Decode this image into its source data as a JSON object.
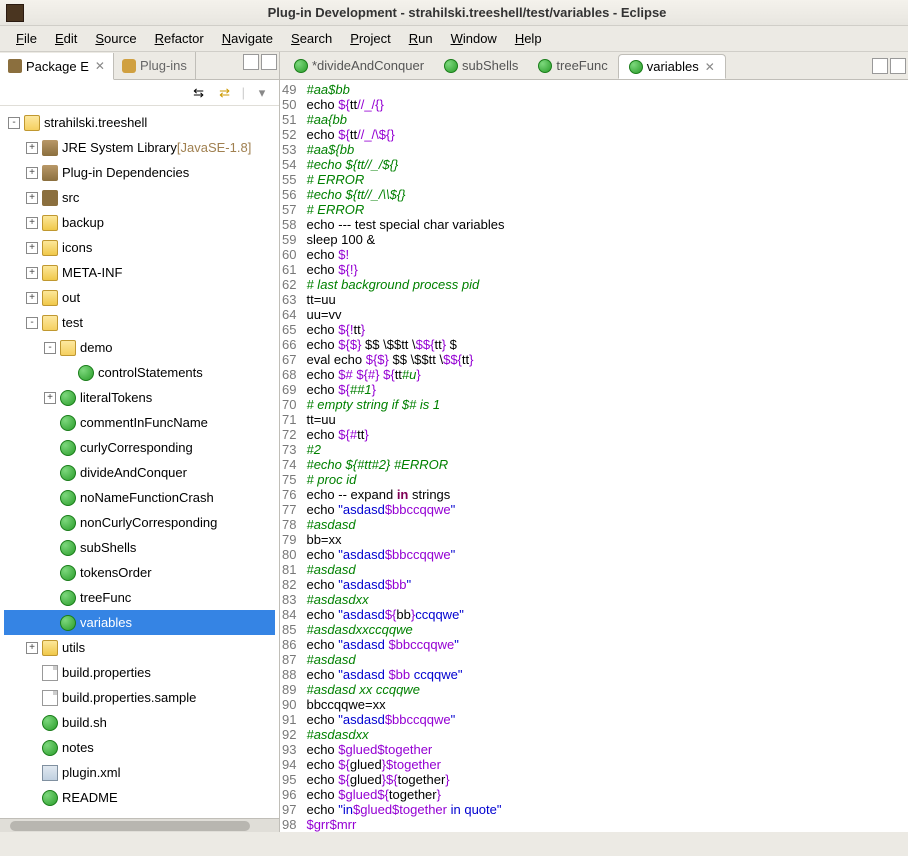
{
  "title": "Plug-in Development - strahilski.treeshell/test/variables - Eclipse",
  "menu": [
    "File",
    "Edit",
    "Source",
    "Refactor",
    "Navigate",
    "Search",
    "Project",
    "Run",
    "Window",
    "Help"
  ],
  "views": {
    "package_explorer": "Package E",
    "plugins": "Plug-ins"
  },
  "tree": {
    "project": "strahilski.treeshell",
    "jre": "JRE System Library",
    "jre_ver": "[JavaSE-1.8]",
    "plugin_deps": "Plug-in Dependencies",
    "src": "src",
    "backup": "backup",
    "icons": "icons",
    "meta": "META-INF",
    "out": "out",
    "test": "test",
    "demo": "demo",
    "controlStatements": "controlStatements",
    "literalTokens": "literalTokens",
    "commentInFuncName": "commentInFuncName",
    "curlyCorresponding": "curlyCorresponding",
    "divideAndConquer": "divideAndConquer",
    "noNameFunctionCrash": "noNameFunctionCrash",
    "nonCurlyCorresponding": "nonCurlyCorresponding",
    "subShells": "subShells",
    "tokensOrder": "tokensOrder",
    "treeFunc": "treeFunc",
    "variables": "variables",
    "utils": "utils",
    "build_props": "build.properties",
    "build_props_sample": "build.properties.sample",
    "build_sh": "build.sh",
    "notes": "notes",
    "plugin_xml": "plugin.xml",
    "readme": "README"
  },
  "editor_tabs": {
    "t1": "*divideAndConquer",
    "t2": "subShells",
    "t3": "treeFunc",
    "t4": "variables"
  },
  "code_start": 49,
  "code": [
    {
      "t": [
        [
          "g",
          "#aa$bb"
        ]
      ]
    },
    {
      "t": [
        [
          "",
          "echo "
        ],
        [
          "p",
          "${"
        ],
        [
          "",
          "tt"
        ],
        [
          "p",
          "//_/{}"
        ]
      ]
    },
    {
      "t": [
        [
          "g",
          "#aa{bb"
        ]
      ]
    },
    {
      "t": [
        [
          "",
          "echo "
        ],
        [
          "p",
          "${"
        ],
        [
          "",
          "tt"
        ],
        [
          "p",
          "//_/\\${}"
        ]
      ]
    },
    {
      "t": [
        [
          "g",
          "#aa${bb"
        ]
      ]
    },
    {
      "t": [
        [
          "g",
          "#echo ${tt//_/${}"
        ]
      ]
    },
    {
      "t": [
        [
          "g",
          "# ERROR"
        ]
      ]
    },
    {
      "t": [
        [
          "g",
          "#echo ${tt//_/\\\\${}"
        ]
      ]
    },
    {
      "t": [
        [
          "g",
          "# ERROR"
        ]
      ]
    },
    {
      "t": [
        [
          "",
          "echo --- test special char variables"
        ]
      ]
    },
    {
      "t": [
        [
          "",
          "sleep 100 &"
        ]
      ]
    },
    {
      "t": [
        [
          "",
          "echo "
        ],
        [
          "p",
          "$!"
        ]
      ]
    },
    {
      "t": [
        [
          "",
          "echo "
        ],
        [
          "p",
          "${!}"
        ]
      ]
    },
    {
      "t": [
        [
          "g",
          "# last background process pid"
        ]
      ]
    },
    {
      "t": [
        [
          "",
          "tt=uu"
        ]
      ]
    },
    {
      "t": [
        [
          "",
          "uu=vv"
        ]
      ]
    },
    {
      "t": [
        [
          "",
          "echo "
        ],
        [
          "p",
          "${!"
        ],
        [
          "",
          "tt"
        ],
        [
          "p",
          "}"
        ]
      ]
    },
    {
      "t": [
        [
          "",
          "echo "
        ],
        [
          "p",
          "${$}"
        ],
        [
          "",
          " $$ \\$$tt \\"
        ],
        [
          "p",
          "$${"
        ],
        [
          "",
          "tt"
        ],
        [
          "p",
          "}"
        ],
        [
          "",
          " $"
        ]
      ]
    },
    {
      "t": [
        [
          "",
          "eval echo "
        ],
        [
          "p",
          "${$}"
        ],
        [
          "",
          " $$ \\$$tt \\"
        ],
        [
          "p",
          "$${"
        ],
        [
          "",
          "tt"
        ],
        [
          "p",
          "}"
        ]
      ]
    },
    {
      "t": [
        [
          "",
          "echo "
        ],
        [
          "p",
          "$# ${#} ${"
        ],
        [
          "",
          "tt"
        ],
        [
          "g",
          "#u"
        ],
        [
          "p",
          "}"
        ]
      ]
    },
    {
      "t": [
        [
          "",
          "echo "
        ],
        [
          "p",
          "${"
        ],
        [
          "g",
          "##1"
        ],
        [
          "p",
          "}"
        ]
      ]
    },
    {
      "t": [
        [
          "g",
          "# empty string if $# is 1"
        ]
      ]
    },
    {
      "t": [
        [
          "",
          "tt=uu"
        ]
      ]
    },
    {
      "t": [
        [
          "",
          "echo "
        ],
        [
          "p",
          "${#"
        ],
        [
          "",
          "tt"
        ],
        [
          "p",
          "}"
        ]
      ]
    },
    {
      "t": [
        [
          "g",
          "#2"
        ]
      ]
    },
    {
      "t": [
        [
          "g",
          "#echo ${#tt#2} #ERROR"
        ]
      ]
    },
    {
      "t": [
        [
          "g",
          "# proc id"
        ]
      ]
    },
    {
      "t": [
        [
          "",
          "echo -- expand "
        ],
        [
          "kw",
          "in"
        ],
        [
          "",
          " strings"
        ]
      ]
    },
    {
      "t": [
        [
          "",
          "echo "
        ],
        [
          "b",
          "\"asdasd"
        ],
        [
          "p",
          "$bbccqqwe"
        ],
        [
          "b",
          "\""
        ]
      ]
    },
    {
      "t": [
        [
          "g",
          "#asdasd"
        ]
      ]
    },
    {
      "t": [
        [
          "",
          "bb=xx"
        ]
      ]
    },
    {
      "t": [
        [
          "",
          "echo "
        ],
        [
          "b",
          "\"asdasd"
        ],
        [
          "p",
          "$bbccqqwe"
        ],
        [
          "b",
          "\""
        ]
      ]
    },
    {
      "t": [
        [
          "g",
          "#asdasd"
        ]
      ]
    },
    {
      "t": [
        [
          "",
          "echo "
        ],
        [
          "b",
          "\"asdasd"
        ],
        [
          "p",
          "$bb"
        ],
        [
          "b",
          "\""
        ]
      ]
    },
    {
      "t": [
        [
          "g",
          "#asdasdxx"
        ]
      ]
    },
    {
      "t": [
        [
          "",
          "echo "
        ],
        [
          "b",
          "\"asdasd"
        ],
        [
          "p",
          "${"
        ],
        [
          "",
          "bb"
        ],
        [
          "p",
          "}"
        ],
        [
          "b",
          "ccqqwe\""
        ]
      ]
    },
    {
      "t": [
        [
          "g",
          "#asdasdxxccqqwe"
        ]
      ]
    },
    {
      "t": [
        [
          "",
          "echo "
        ],
        [
          "b",
          "\"asdasd "
        ],
        [
          "p",
          "$bbccqqwe"
        ],
        [
          "b",
          "\""
        ]
      ]
    },
    {
      "t": [
        [
          "g",
          "#asdasd"
        ]
      ]
    },
    {
      "t": [
        [
          "",
          "echo "
        ],
        [
          "b",
          "\"asdasd "
        ],
        [
          "p",
          "$bb"
        ],
        [
          "b",
          " ccqqwe\""
        ]
      ]
    },
    {
      "t": [
        [
          "g",
          "#asdasd xx ccqqwe"
        ]
      ]
    },
    {
      "t": [
        [
          "",
          "bbccqqwe=xx"
        ]
      ]
    },
    {
      "t": [
        [
          "",
          "echo "
        ],
        [
          "b",
          "\"asdasd"
        ],
        [
          "p",
          "$bbccqqwe"
        ],
        [
          "b",
          "\""
        ]
      ]
    },
    {
      "t": [
        [
          "g",
          "#asdasdxx"
        ]
      ]
    },
    {
      "t": [
        [
          "",
          "echo "
        ],
        [
          "p",
          "$glued$together"
        ]
      ]
    },
    {
      "t": [
        [
          "",
          "echo "
        ],
        [
          "p",
          "${"
        ],
        [
          "",
          "glued"
        ],
        [
          "p",
          "}$together"
        ]
      ]
    },
    {
      "t": [
        [
          "",
          "echo "
        ],
        [
          "p",
          "${"
        ],
        [
          "",
          "glued"
        ],
        [
          "p",
          "}${"
        ],
        [
          "",
          "together"
        ],
        [
          "p",
          "}"
        ]
      ]
    },
    {
      "t": [
        [
          "",
          "echo "
        ],
        [
          "p",
          "$glued${"
        ],
        [
          "",
          "together"
        ],
        [
          "p",
          "}"
        ]
      ]
    },
    {
      "t": [
        [
          "",
          "echo "
        ],
        [
          "b",
          "\"in"
        ],
        [
          "p",
          "$glued$together"
        ],
        [
          "b",
          " in quote\""
        ]
      ]
    },
    {
      "t": [
        [
          "p",
          "$grr$mrr"
        ]
      ]
    }
  ]
}
